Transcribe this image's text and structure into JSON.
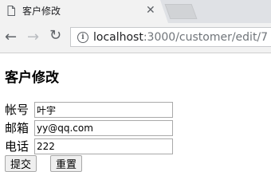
{
  "browser": {
    "tab": {
      "title": "客户修改",
      "close_glyph": "✕"
    },
    "nav": {
      "back_glyph": "←",
      "forward_glyph": "→",
      "reload_glyph": "↻"
    },
    "address": {
      "host": "localhost",
      "path": ":3000/customer/edit/7",
      "info_glyph": "i"
    }
  },
  "page": {
    "title": "客户修改",
    "form": {
      "fields": [
        {
          "label": "帐号",
          "value": "叶宇"
        },
        {
          "label": "邮箱",
          "value": "yy@qq.com"
        },
        {
          "label": "电话",
          "value": "222"
        }
      ],
      "submit_label": "提交",
      "reset_label": "重置"
    }
  }
}
